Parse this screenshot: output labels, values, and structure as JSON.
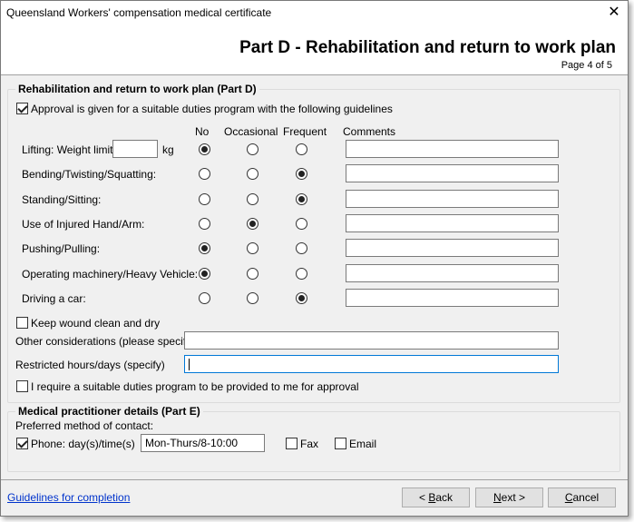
{
  "window": {
    "title": "Queensland Workers' compensation medical certificate"
  },
  "header": {
    "title": "Part D - Rehabilitation and return to work plan",
    "page": "Page 4 of 5"
  },
  "partD": {
    "group_title": "Rehabilitation and return to work plan (Part D)",
    "approval_label": "Approval is given for a suitable duties program with the following guidelines",
    "approval_checked": true,
    "columns": {
      "no": "No",
      "occasional": "Occasional",
      "frequent": "Frequent",
      "comments": "Comments"
    },
    "weight_unit": "kg",
    "weight_value": "",
    "rows": [
      {
        "label": "Lifting: Weight limit",
        "selected": "no",
        "comment": ""
      },
      {
        "label": "Bending/Twisting/Squatting:",
        "selected": "frequent",
        "comment": ""
      },
      {
        "label": "Standing/Sitting:",
        "selected": "frequent",
        "comment": ""
      },
      {
        "label": "Use of Injured Hand/Arm:",
        "selected": "occasional",
        "comment": ""
      },
      {
        "label": "Pushing/Pulling:",
        "selected": "no",
        "comment": ""
      },
      {
        "label": "Operating machinery/Heavy Vehicle:",
        "selected": "no",
        "comment": ""
      },
      {
        "label": "Driving a car:",
        "selected": "frequent",
        "comment": ""
      }
    ],
    "wound_label": "Keep wound clean and dry",
    "wound_checked": false,
    "other_label": "Other considerations (please specify)",
    "other_value": "",
    "restricted_label": "Restricted hours/days (specify)",
    "restricted_value": "",
    "require_label": "I require a suitable duties program to be provided to me for approval",
    "require_checked": false
  },
  "partE": {
    "group_title": "Medical practitioner details (Part E)",
    "contact_label": "Preferred method of contact:",
    "phone_label": "Phone: day(s)/time(s)",
    "phone_checked": true,
    "phone_value": "Mon-Thurs/8-10:00",
    "fax_label": "Fax",
    "fax_checked": false,
    "email_label": "Email",
    "email_checked": false
  },
  "footer": {
    "guidelines_link": "Guidelines for completion",
    "back_prefix": "< ",
    "back_key": "B",
    "back_rest": "ack",
    "next_key": "N",
    "next_rest": "ext >",
    "cancel_key": "C",
    "cancel_rest": "ancel"
  }
}
